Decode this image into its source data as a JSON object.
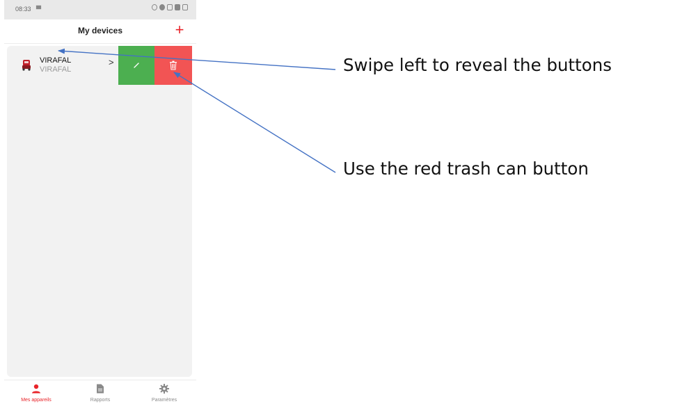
{
  "status_bar": {
    "time": "08:33"
  },
  "header": {
    "title": "My devices",
    "add_label": "+"
  },
  "devices": [
    {
      "name": "VIRAFAL",
      "subtitle": "VIRAFAL",
      "chevron": ">"
    }
  ],
  "bottom_nav": [
    {
      "label": "Mes appareils",
      "icon": "person-icon",
      "active": true
    },
    {
      "label": "Rapports",
      "icon": "document-icon",
      "active": false
    },
    {
      "label": "Paramètres",
      "icon": "gear-icon",
      "active": false
    }
  ],
  "annotations": [
    {
      "text": "Swipe left to reveal the buttons"
    },
    {
      "text": "Use the red trash can button"
    }
  ],
  "colors": {
    "accent": "#e8242a",
    "edit": "#4caf50",
    "delete": "#f25454",
    "arrow": "#4472c4"
  }
}
